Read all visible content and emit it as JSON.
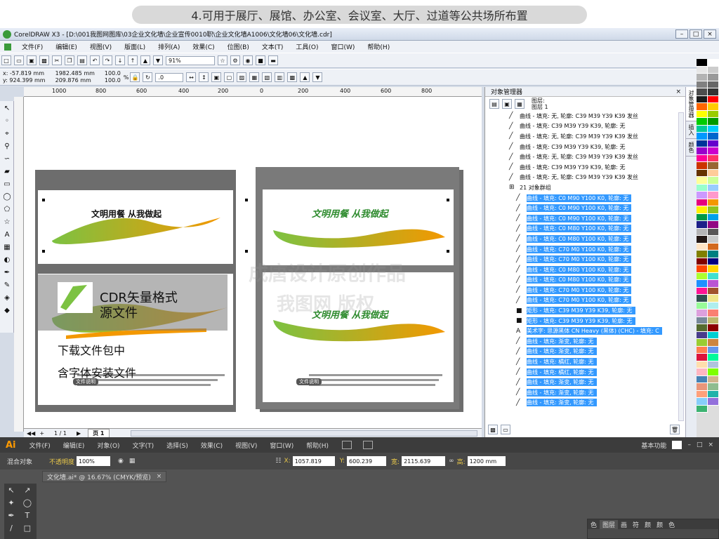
{
  "banner": {
    "text": "4.可用于展厅、展馆、办公室、会议室、大厅、过道等公共场所布置"
  },
  "cdr": {
    "title": "CorelDRAW X3 - [D:\\001我图网图库\\03企业文化墙\\企业宣传0010职\\企业文化墙A1006\\文化墙06\\文化墙.cdr]",
    "menu": [
      "文件(F)",
      "编辑(E)",
      "视图(V)",
      "版面(L)",
      "排列(A)",
      "效果(C)",
      "位图(B)",
      "文本(T)",
      "工具(O)",
      "窗口(W)",
      "帮助(H)"
    ],
    "zoom": "91%",
    "pos_x": "x: -57.819 mm",
    "pos_y": "y: 924.399 mm",
    "size_w": "1982.485 mm",
    "size_h": "209.876 mm",
    "scale_x": "100.0",
    "scale_y": "100.0",
    "scale_unit": "%",
    "angle": ".0",
    "ruler_h_ticks": [
      "1000",
      "800",
      "600",
      "400",
      "200",
      "0",
      "200",
      "400",
      "600",
      "800"
    ],
    "page_nav": {
      "counter": "1 / 1",
      "page_tab": "页 1"
    }
  },
  "artboards": {
    "slogan_a": "文明用餐 从我做起",
    "slogan_b": "文明用餐 从我做起",
    "overlay_title": "CDR矢量格式",
    "overlay_sub": "源文件",
    "download_note": "下载文件包中",
    "font_note": "含字体安装文件",
    "doc_label": "文件说明",
    "watermark1": "成唐设计原创作品",
    "watermark2": "我图网 版权"
  },
  "object_manager": {
    "title": "对象管理器",
    "layer_label": "图层:",
    "layer_name": "图层 1",
    "group_label": "21 对象群组",
    "rows_top": [
      "曲线 - 填充: 无, 轮廓: C39 M39 Y39 K39 发丝",
      "曲线 - 填充: C39 M39 Y39 K39, 轮廓: 无",
      "曲线 - 填充: 无, 轮廓: C39 M39 Y39 K39 发丝",
      "曲线 - 填充: C39 M39 Y39 K39, 轮廓: 无",
      "曲线 - 填充: 无, 轮廓: C39 M39 Y39 K39 发丝",
      "曲线 - 填充: C39 M39 Y39 K39, 轮廓: 无",
      "曲线 - 填充: 无, 轮廓: C39 M39 Y39 K39 发丝"
    ],
    "rows_selected": [
      "曲线 - 填充: C0 M90 Y100 K0, 轮廓: 无",
      "曲线 - 填充: C0 M90 Y100 K0, 轮廓: 无",
      "曲线 - 填充: C0 M90 Y100 K0, 轮廓: 无",
      "曲线 - 填充: C0 M80 Y100 K0, 轮廓: 无",
      "曲线 - 填充: C0 M80 Y100 K0, 轮廓: 无",
      "曲线 - 填充: C70 M0 Y100 K0, 轮廓: 无",
      "曲线 - 填充: C70 M0 Y100 K0, 轮廓: 无",
      "曲线 - 填充: C0 M80 Y100 K0, 轮廓: 无",
      "曲线 - 填充: C0 M80 Y100 K0, 轮廓: 无",
      "曲线 - 填充: C70 M0 Y100 K0, 轮廓: 无",
      "曲线 - 填充: C70 M0 Y100 K0, 轮廓: 无",
      "矩形 - 填充: C39 M39 Y39 K39, 轮廓: 无",
      "矩形 - 填充: C39 M39 Y39 K39, 轮廓: 无",
      "美术字: 思源黑体 CN Heavy (黑体) (CHC) - 填充: C",
      "曲线 - 填充: 渐变, 轮廓: 无",
      "曲线 - 填充: 渐变, 轮廓: 无",
      "曲线 - 填充: 橘红, 轮廓: 无",
      "曲线 - 填充: 橘红, 轮廓: 无",
      "曲线 - 填充: 渐变, 轮廓: 无",
      "曲线 - 填充: 渐变, 轮廓: 无",
      "曲线 - 填充: 渐变, 轮廓: 无"
    ],
    "dock_tabs": [
      "对象管理器",
      "插入",
      "颜色"
    ]
  },
  "palette": [
    "#000000",
    "#ffffff",
    "#e6e6e6",
    "#cccccc",
    "#b3b3b3",
    "#999999",
    "#808080",
    "#666666",
    "#4d4d4d",
    "#333333",
    "#1a1a1a",
    "#ff0000",
    "#ff6600",
    "#ffcc00",
    "#ffff00",
    "#99cc00",
    "#00cc00",
    "#009900",
    "#00cc99",
    "#00ccff",
    "#0099ff",
    "#0066cc",
    "#003399",
    "#6600cc",
    "#9900cc",
    "#cc00cc",
    "#ff0099",
    "#ff3366",
    "#cc3300",
    "#996633",
    "#663300",
    "#ffcc99",
    "#ffff99",
    "#ccff99",
    "#99ffcc",
    "#99ccff",
    "#cc99ff",
    "#ff99cc",
    "#e6007e",
    "#f39800",
    "#fff100",
    "#8fc31f",
    "#009944",
    "#00a0e9",
    "#1d2088",
    "#920783",
    "#b5b5b6",
    "#595757",
    "#231815",
    "#c9caca",
    "#ffe4c4",
    "#d2691e",
    "#808000",
    "#008080",
    "#800000",
    "#000080",
    "#ff4500",
    "#ffd700",
    "#adff2f",
    "#40e0d0",
    "#1e90ff",
    "#ba55d3",
    "#ff1493",
    "#a0522d",
    "#2f4f4f",
    "#f0e68c",
    "#98fb98",
    "#afeeee",
    "#dda0dd",
    "#fa8072",
    "#778899",
    "#bdb76b",
    "#556b2f",
    "#8b0000",
    "#483d8b",
    "#00ced1",
    "#9acd32",
    "#cd853f",
    "#ff7f50",
    "#6495ed",
    "#dc143c",
    "#00fa9a",
    "#ffdead",
    "#b0c4de",
    "#ffb6c1",
    "#7fff00",
    "#4682b4",
    "#d2b48c",
    "#e9967a",
    "#8fbc8f",
    "#ffa07a",
    "#20b2aa",
    "#87cefa",
    "#9370db",
    "#3cb371"
  ],
  "ai": {
    "logo": "Ai",
    "menu": [
      "文件(F)",
      "编辑(E)",
      "对象(O)",
      "文字(T)",
      "选择(S)",
      "效果(C)",
      "视图(V)",
      "窗口(W)",
      "帮助(H)"
    ],
    "workspace": "基本功能",
    "ctrl_label": "混合对象",
    "opacity_label": "不透明度",
    "opacity_value": "100%",
    "x_label": "X:",
    "x_value": "1057.819",
    "y_label": "Y:",
    "y_value": "600.239",
    "w_label": "宽:",
    "w_value": "2115.639",
    "h_label": "高:",
    "h_value": "1200 mm",
    "doc_tab": "文化墙.ai* @ 16.67% (CMYK/预览)",
    "panel_tabs": [
      "色",
      "图层",
      "画",
      "符",
      "颜",
      "颜",
      "色"
    ]
  }
}
